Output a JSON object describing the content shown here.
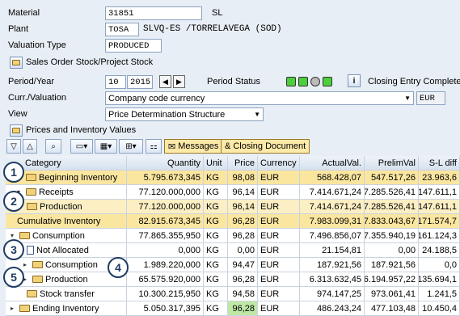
{
  "header": {
    "material": {
      "label": "Material",
      "value": "31851",
      "unit": "SL"
    },
    "plant": {
      "label": "Plant",
      "value": "TOSA",
      "desc": "SLVQ-ES /TORRELAVEGA   (SOD)"
    },
    "valuation_type": {
      "label": "Valuation Type",
      "value": "PRODUCED"
    },
    "sales_order_btn": "Sales Order Stock/Project Stock",
    "period": {
      "label": "Period/Year",
      "period": "10",
      "year": "2015",
      "status_label": "Period Status",
      "closing": "Closing Entry Complete"
    },
    "curr": {
      "label": "Curr./Valuation",
      "value": "Company code currency",
      "currency": "EUR"
    },
    "view": {
      "label": "View",
      "value": "Price Determination Structure"
    },
    "prices_btn": "Prices and Inventory Values"
  },
  "toolbar": {
    "messages": "Messages",
    "closing_document": "Closing Document"
  },
  "columns": [
    "Category",
    "Quantity",
    "Unit",
    "Price",
    "Currency",
    "ActualVal.",
    "PrelimVal",
    "S-L diff"
  ],
  "rows": [
    {
      "cat": "Beginning Inventory",
      "qty": "5.795.673,345",
      "unit": "KG",
      "price": "98,08",
      "cur": "EUR",
      "act": "568.428,07",
      "pre": "547.517,26",
      "diff": "23.963,6"
    },
    {
      "cat": "Receipts",
      "qty": "77.120.000,000",
      "unit": "KG",
      "price": "96,14",
      "cur": "EUR",
      "act": "7.414.671,24",
      "pre": "7.285.526,41",
      "diff": "147.611,1"
    },
    {
      "cat": "Production",
      "qty": "77.120.000,000",
      "unit": "KG",
      "price": "96,14",
      "cur": "EUR",
      "act": "7.414.671,24",
      "pre": "7.285.526,41",
      "diff": "147.611,1"
    },
    {
      "cat": "Cumulative Inventory",
      "qty": "82.915.673,345",
      "unit": "KG",
      "price": "96,28",
      "cur": "EUR",
      "act": "7.983.099,31",
      "pre": "7.833.043,67",
      "diff": "171.574,7"
    },
    {
      "cat": "Consumption",
      "qty": "77.865.355,950",
      "unit": "KG",
      "price": "96,28",
      "cur": "EUR",
      "act": "7.496.856,07",
      "pre": "7.355.940,19",
      "diff": "161.124,3"
    },
    {
      "cat": "Not Allocated",
      "qty": "0,000",
      "unit": "KG",
      "price": "0,00",
      "cur": "EUR",
      "act": "21.154,81",
      "pre": "0,00",
      "diff": "24.188,5"
    },
    {
      "cat": "Consumption",
      "qty": "1.989.220,000",
      "unit": "KG",
      "price": "94,47",
      "cur": "EUR",
      "act": "187.921,56",
      "pre": "187.921,56",
      "diff": "0,0"
    },
    {
      "cat": "Production",
      "qty": "65.575.920,000",
      "unit": "KG",
      "price": "96,28",
      "cur": "EUR",
      "act": "6.313.632,45",
      "pre": "6.194.957,22",
      "diff": "135.694,1"
    },
    {
      "cat": "Stock transfer",
      "qty": "10.300.215,950",
      "unit": "KG",
      "price": "94,58",
      "cur": "EUR",
      "act": "974.147,25",
      "pre": "973.061,41",
      "diff": "1.241,5"
    },
    {
      "cat": "Ending Inventory",
      "qty": "5.050.317,395",
      "unit": "KG",
      "price": "96,28",
      "cur": "EUR",
      "act": "486.243,24",
      "pre": "477.103,48",
      "diff": "10.450,4"
    }
  ],
  "badges": [
    "1",
    "2",
    "3",
    "4",
    "5"
  ]
}
